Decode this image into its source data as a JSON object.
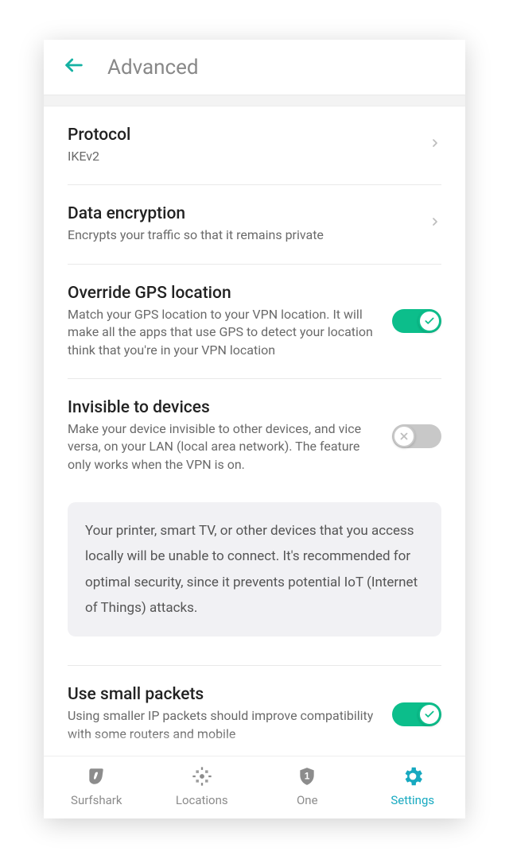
{
  "header": {
    "title": "Advanced"
  },
  "items": {
    "protocol": {
      "title": "Protocol",
      "sub": "IKEv2"
    },
    "encryption": {
      "title": "Data encryption",
      "sub": "Encrypts your traffic so that it remains private"
    },
    "gps": {
      "title": "Override GPS location",
      "sub": "Match your GPS location to your VPN location. It will make all the apps that use GPS to detect your location think that you're in your VPN location"
    },
    "invisible": {
      "title": "Invisible to devices",
      "sub": "Make your device invisible to other devices, and vice versa, on your LAN (local area network). The feature only works when the VPN is on.",
      "note": "Your printer, smart TV, or other devices that you access locally will be unable to connect. It's recommended for optimal security, since it prevents potential IoT (Internet of Things) attacks."
    },
    "smallpackets": {
      "title": "Use small packets",
      "sub": "Using smaller IP packets should improve compatibility with some routers and mobile"
    }
  },
  "nav": {
    "surfshark": "Surfshark",
    "locations": "Locations",
    "one": "One",
    "settings": "Settings"
  }
}
